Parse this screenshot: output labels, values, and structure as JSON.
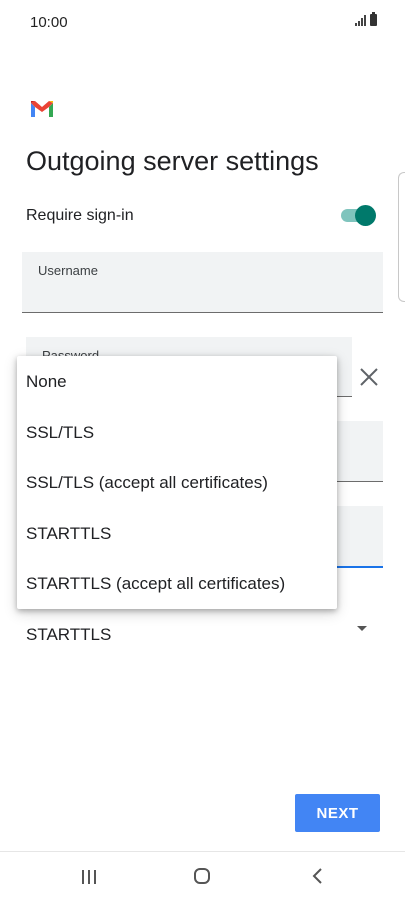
{
  "status_bar": {
    "time": "10:00"
  },
  "screen": {
    "title": "Outgoing server settings",
    "require_signin": {
      "label": "Require sign-in",
      "enabled": true
    },
    "username": {
      "label": "Username",
      "value": ""
    },
    "password": {
      "label": "Password",
      "value": ""
    }
  },
  "dropdown": {
    "options": [
      "None",
      "SSL/TLS",
      "SSL/TLS (accept all certificates)",
      "STARTTLS",
      "STARTTLS (accept all certificates)"
    ]
  },
  "security_type": {
    "selected": "STARTTLS"
  },
  "buttons": {
    "next": "NEXT"
  },
  "colors": {
    "accent": "#4285f4",
    "toggle_on": "#00796b",
    "focus_underline": "#1a73e8"
  },
  "icons": [
    "gmail-logo",
    "signal-icon",
    "battery-icon",
    "close-icon",
    "chevron-down-icon",
    "recent-apps-icon",
    "home-icon",
    "back-icon"
  ]
}
